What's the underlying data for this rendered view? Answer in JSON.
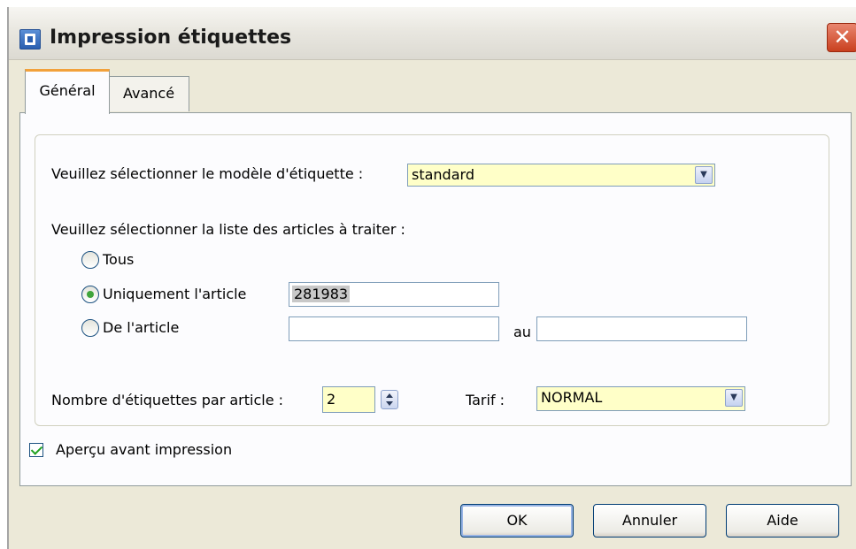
{
  "window": {
    "title": "Impression étiquettes",
    "close_glyph": "✕"
  },
  "tabs": [
    {
      "label": "Général",
      "active": true
    },
    {
      "label": "Avancé",
      "active": false
    }
  ],
  "modele": {
    "label": "Veuillez sélectionner le modèle d'étiquette :",
    "value": "standard"
  },
  "liste": {
    "label": "Veuillez sélectionner la liste des articles à traiter :",
    "options": [
      {
        "label": "Tous",
        "checked": false
      },
      {
        "label": "Uniquement l'article",
        "checked": true
      },
      {
        "label": "De l'article",
        "checked": false
      }
    ],
    "article_value": "281983",
    "de_value": "",
    "au_label": "au",
    "au_value": ""
  },
  "nombre": {
    "label": "Nombre d'étiquettes par article :",
    "value": "2"
  },
  "tarif": {
    "label": "Tarif :",
    "value": "NORMAL"
  },
  "apercu": {
    "label": "Aperçu avant impression",
    "checked": true
  },
  "buttons": {
    "ok": "OK",
    "annuler": "Annuler",
    "aide": "Aide"
  },
  "colors": {
    "field_yellow": "#ffffc8",
    "tab_accent": "#f2a13a",
    "close_red": "#c9401f",
    "dialog_bg": "#ece9d8"
  },
  "icons": {
    "app": "app-window-icon",
    "dropdown": "chevron-down-icon",
    "spinner": "up-down-arrows-icon"
  }
}
